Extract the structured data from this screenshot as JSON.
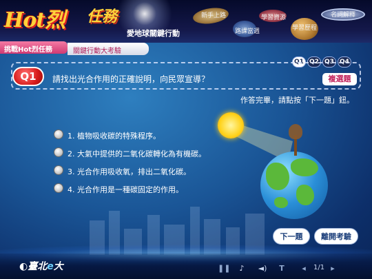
{
  "header": {
    "logo_hot": "Hot",
    "logo_hot_suffix": "烈",
    "logo_mission": "任務",
    "subtitle": "愛地球關鍵行動"
  },
  "nav": [
    {
      "label": "新手上路"
    },
    {
      "label": "路課當週"
    },
    {
      "label": "學習資源"
    },
    {
      "label": "學習歷程"
    },
    {
      "label": "名詞解釋"
    }
  ],
  "tabs": {
    "challenge": "挑戰Hot烈任務",
    "exam": "關鍵行動大考驗"
  },
  "question": {
    "badge": "Q1",
    "text": "請找出光合作用的正確說明，向民眾宣導？",
    "type_badge": "複選題",
    "nav": [
      "Q1",
      "Q2",
      "Q3",
      "Q4"
    ],
    "instruction": "作答完畢，請點按「下一題」鈕。",
    "options": [
      "1. 植物吸收碳的特殊程序。",
      "2. 大氣中提供的二氧化碳轉化為有機碳。",
      "3. 光合作用吸收氧，排出二氧化碳。",
      "4. 光合作用是一種碳固定的作用。"
    ]
  },
  "buttons": {
    "next": "下一題",
    "leave": "離開考驗"
  },
  "footer": {
    "brand_prefix": "臺北",
    "brand_e": "e",
    "brand_suffix": "大",
    "page_indicator": "1/1"
  }
}
